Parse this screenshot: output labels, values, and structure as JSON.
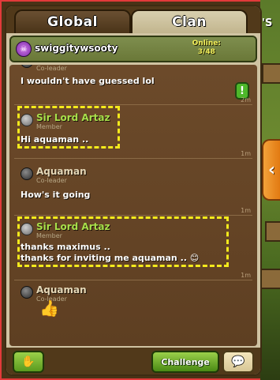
{
  "tabs": {
    "global": "Global",
    "clan": "Clan"
  },
  "hud": {
    "partial_text": "'S"
  },
  "clan": {
    "name": "swiggitywsooty",
    "online_label": "Online:",
    "online_count": "3/48"
  },
  "messages": [
    {
      "sender": "",
      "role": "Co-leader",
      "lines": [
        "I wouldn't have guessed lol"
      ],
      "time": "2m"
    },
    {
      "sender": "Sir Lord Artaz",
      "role": "Member",
      "lines": [
        "Hi aquaman .."
      ],
      "time": "1m"
    },
    {
      "sender": "Aquaman",
      "role": "Co-leader",
      "lines": [
        "How's it going"
      ],
      "time": "1m"
    },
    {
      "sender": "Sir Lord Artaz",
      "role": "Member",
      "lines": [
        "thanks maximus ..",
        "thanks for inviting me aquaman .. 😊"
      ],
      "time": "1m"
    },
    {
      "sender": "Aquaman",
      "role": "Co-leader",
      "lines": [
        "👍"
      ],
      "time": ""
    }
  ],
  "buttons": {
    "challenge": "Challenge"
  },
  "icons": {
    "alert": "exclamation-icon",
    "toggle": "chevron-left-icon",
    "donate": "donate-icon",
    "chat": "chat-bubble-icon",
    "clan_badge": "clan-badge-icon"
  },
  "colors": {
    "member_name": "#a8e04a",
    "highlight": "#f4ea1c",
    "accent_green": "#5a9a1e",
    "frame_border": "#e23a3a"
  }
}
